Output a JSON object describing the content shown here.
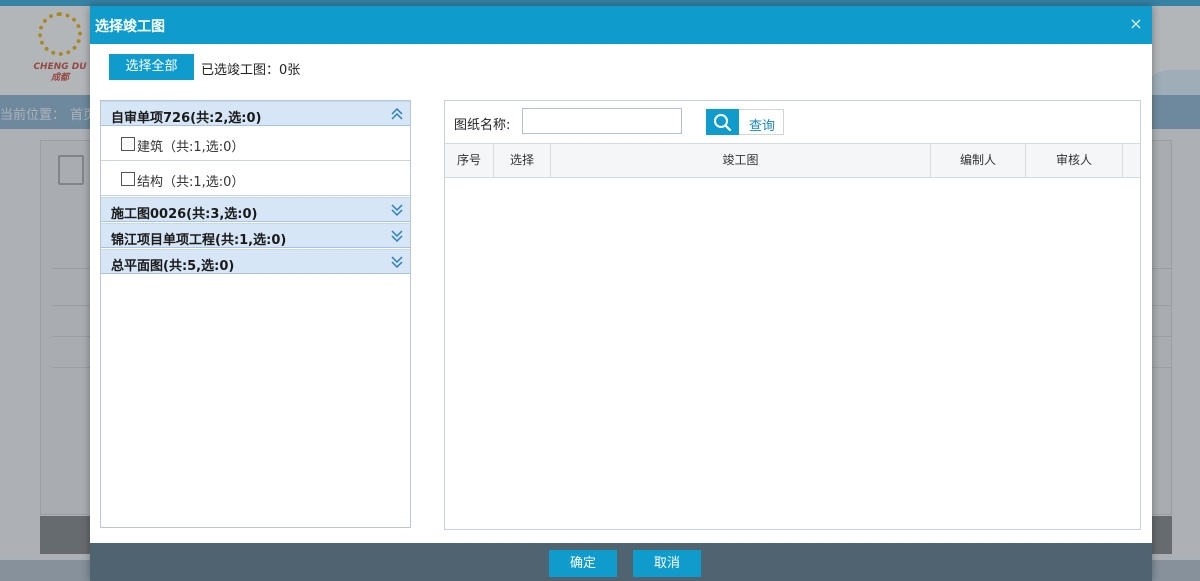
{
  "background": {
    "logo_text": "CHENG DU",
    "logo_sub": "成都",
    "nav_label": "当前位置：",
    "nav_home": "首页"
  },
  "dialog": {
    "title": "选择竣工图",
    "close_glyph": "×",
    "select_all_label": "选择全部",
    "selected_count": "已选竣工图：0张",
    "accordion": [
      {
        "label": "自审单项726(共:2,选:0)",
        "expanded": true,
        "items": [
          {
            "label": "建筑（共:1,选:0）",
            "checked": false
          },
          {
            "label": "结构（共:1,选:0）",
            "checked": false
          }
        ]
      },
      {
        "label": "施工图0026(共:3,选:0)",
        "expanded": false,
        "items": []
      },
      {
        "label": "锦江项目单项工程(共:1,选:0)",
        "expanded": false,
        "items": []
      },
      {
        "label": "总平面图(共:5,选:0)",
        "expanded": false,
        "items": []
      }
    ],
    "search": {
      "label": "图纸名称:",
      "value": "",
      "placeholder": "",
      "button_label": "查询"
    },
    "grid": {
      "columns": [
        "序号",
        "选择",
        "竣工图",
        "编制人",
        "审核人"
      ],
      "rows": []
    },
    "footer": {
      "ok_label": "确定",
      "cancel_label": "取消"
    }
  },
  "colors": {
    "accent": "#0f9ccd",
    "footer": "#4f6470",
    "accordion_header": "#d6e6f7"
  }
}
